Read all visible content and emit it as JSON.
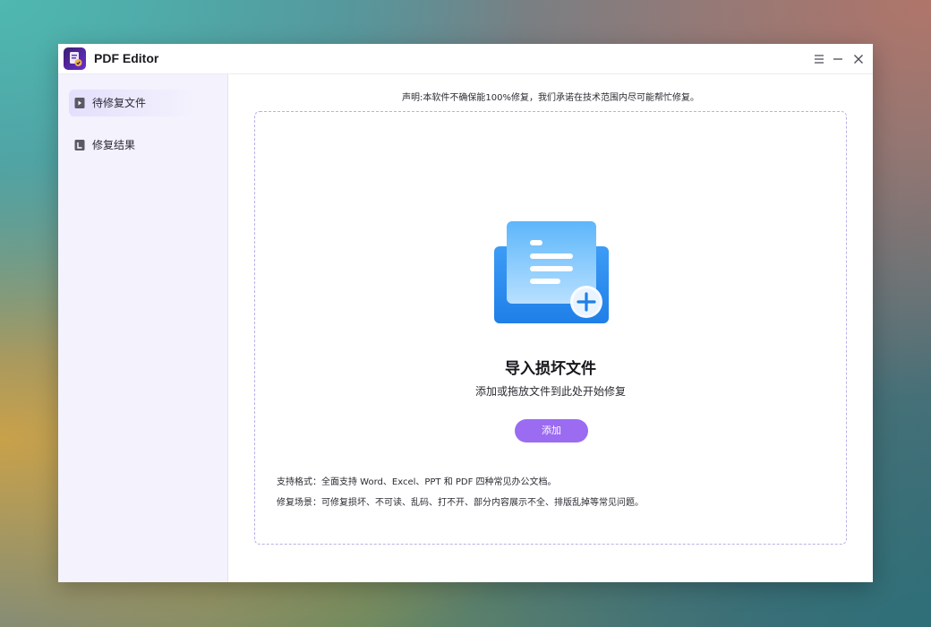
{
  "window": {
    "title": "PDF Editor",
    "controls": [
      "menu-icon",
      "minimize-icon",
      "close-icon"
    ]
  },
  "sidebar": {
    "items": [
      {
        "label": "待修复文件",
        "icon": "pending-file-icon",
        "active": true
      },
      {
        "label": "修复结果",
        "icon": "result-file-icon",
        "active": false
      }
    ]
  },
  "main": {
    "notice": "声明:本软件不确保能100%修复，我们承诺在技术范围内尽可能帮忙修复。",
    "dropzone": {
      "illustration": "document-add-icon",
      "title": "导入损坏文件",
      "subtitle": "添加或拖放文件到此处开始修复",
      "add_button": "添加",
      "formats": "支持格式：全面支持 Word、Excel、PPT 和 PDF 四种常见办公文档。",
      "scenarios": "修复场景：可修复损坏、不可读、乱码、打不开、部分内容展示不全、排版乱掉等常见问题。"
    }
  },
  "colors": {
    "accent": "#9b6bf2",
    "sidebar_bg": "#f3f2fd",
    "dropzone_border": "#b9b0e8",
    "illustration_blue": "#2f8ff0"
  }
}
